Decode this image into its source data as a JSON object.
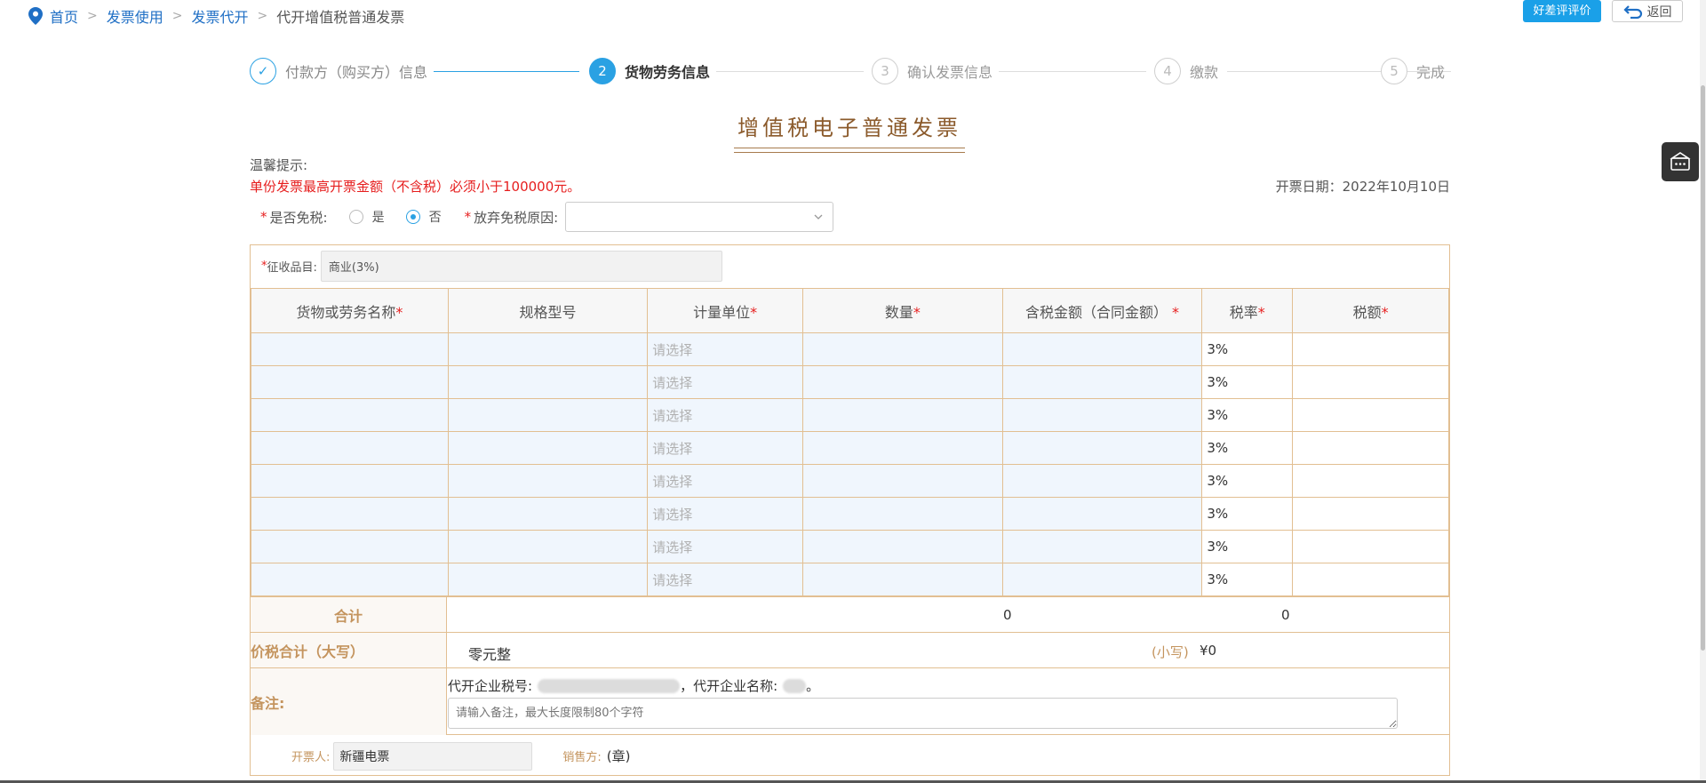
{
  "breadcrumb": {
    "home": "首页",
    "item1": "发票使用",
    "item2": "发票代开",
    "current": "代开增值税普通发票",
    "separator": ">"
  },
  "header": {
    "eval_button": "好差评评价",
    "back_button": "返回"
  },
  "steps": [
    {
      "num": "✓",
      "label": "付款方（购买方）信息",
      "state": "done"
    },
    {
      "num": "2",
      "label": "货物劳务信息",
      "state": "active"
    },
    {
      "num": "3",
      "label": "确认发票信息",
      "state": "pending"
    },
    {
      "num": "4",
      "label": "缴款",
      "state": "pending"
    },
    {
      "num": "5",
      "label": "完成",
      "state": "pending"
    }
  ],
  "invoice_title": "增值税电子普通发票",
  "tip": {
    "title": "温馨提示:",
    "text": "单份发票最高开票金额（不含税）必须小于100000元。"
  },
  "date": "开票日期：2022年10月10日",
  "tax_free": {
    "required_mark": "*",
    "label": "是否免税:",
    "option_yes": "是",
    "option_no": "否",
    "selected": "否",
    "reason_label": "放弃免税原因:",
    "reason_value": ""
  },
  "tax_item": {
    "label": "征收品目:",
    "required_mark": "*",
    "value": "商业(3%)"
  },
  "table": {
    "columns": [
      {
        "label": "货物或劳务名称",
        "required": "*"
      },
      {
        "label": "规格型号",
        "required": ""
      },
      {
        "label": "计量单位",
        "required": "*"
      },
      {
        "label": "数量",
        "required": "*"
      },
      {
        "label": "含税金额（合同金额）",
        "required": " *"
      },
      {
        "label": "税率",
        "required": "*"
      },
      {
        "label": "税额",
        "required": "*"
      }
    ],
    "rows": [
      {
        "name": "",
        "spec": "",
        "unit": "请选择",
        "qty": "",
        "amount": "",
        "rate": "3%",
        "tax": ""
      },
      {
        "name": "",
        "spec": "",
        "unit": "请选择",
        "qty": "",
        "amount": "",
        "rate": "3%",
        "tax": ""
      },
      {
        "name": "",
        "spec": "",
        "unit": "请选择",
        "qty": "",
        "amount": "",
        "rate": "3%",
        "tax": ""
      },
      {
        "name": "",
        "spec": "",
        "unit": "请选择",
        "qty": "",
        "amount": "",
        "rate": "3%",
        "tax": ""
      },
      {
        "name": "",
        "spec": "",
        "unit": "请选择",
        "qty": "",
        "amount": "",
        "rate": "3%",
        "tax": ""
      },
      {
        "name": "",
        "spec": "",
        "unit": "请选择",
        "qty": "",
        "amount": "",
        "rate": "3%",
        "tax": ""
      },
      {
        "name": "",
        "spec": "",
        "unit": "请选择",
        "qty": "",
        "amount": "",
        "rate": "3%",
        "tax": ""
      },
      {
        "name": "",
        "spec": "",
        "unit": "请选择",
        "qty": "",
        "amount": "",
        "rate": "3%",
        "tax": ""
      }
    ]
  },
  "total": {
    "label": "合计",
    "amount": "0",
    "tax": "0"
  },
  "capital": {
    "label": "价税合计（大写）",
    "big": "零元整",
    "small_label": "(小写)",
    "small_value": "¥0"
  },
  "notes": {
    "label": "备注:",
    "tax_id_label": "代开企业税号:",
    "name_label": "，代开企业名称:",
    "end": "。",
    "placeholder": "请输入备注，最大长度限制80个字符"
  },
  "sign": {
    "issuer_label": "开票人:",
    "issuer_value": "新疆电票",
    "seller_label": "销售方:",
    "seal": "(章)"
  },
  "colors": {
    "accent": "#2aa1e3",
    "brown": "#c4945e",
    "red": "#e61e1e",
    "border": "#e2bf92"
  }
}
